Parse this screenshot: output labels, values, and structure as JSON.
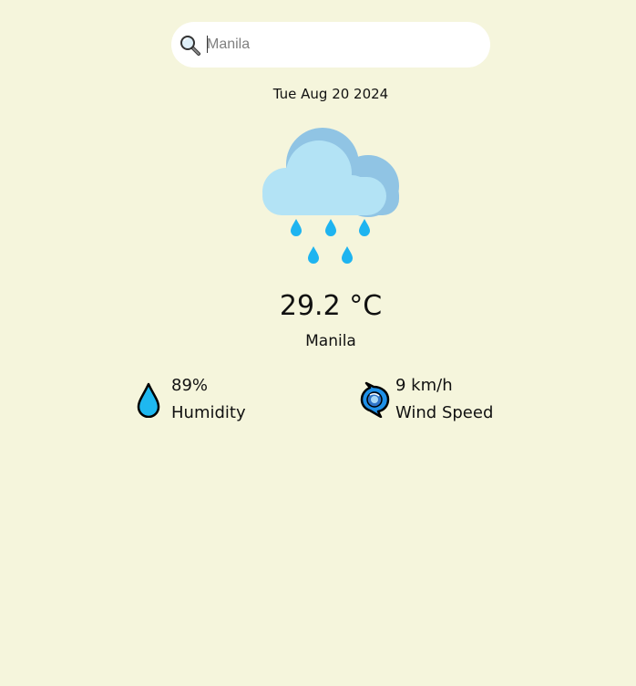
{
  "search": {
    "placeholder": "Manila",
    "value": ""
  },
  "date": "Tue Aug 20 2024",
  "weather": {
    "icon": "rain-cloud-icon",
    "temperature": "29.2 °C",
    "city": "Manila"
  },
  "stats": {
    "humidity": {
      "icon": "droplet-icon",
      "value": "89%",
      "label": "Humidity"
    },
    "wind": {
      "icon": "wind-icon",
      "value": "9 km/h",
      "label": "Wind Speed"
    }
  },
  "colors": {
    "background": "#f5f5dc",
    "cloud_front": "#b3e3f5",
    "cloud_back": "#90c4e4",
    "raindrop": "#1eb4f0",
    "droplet": "#1eb8f0",
    "wind": "#1e90e8"
  }
}
